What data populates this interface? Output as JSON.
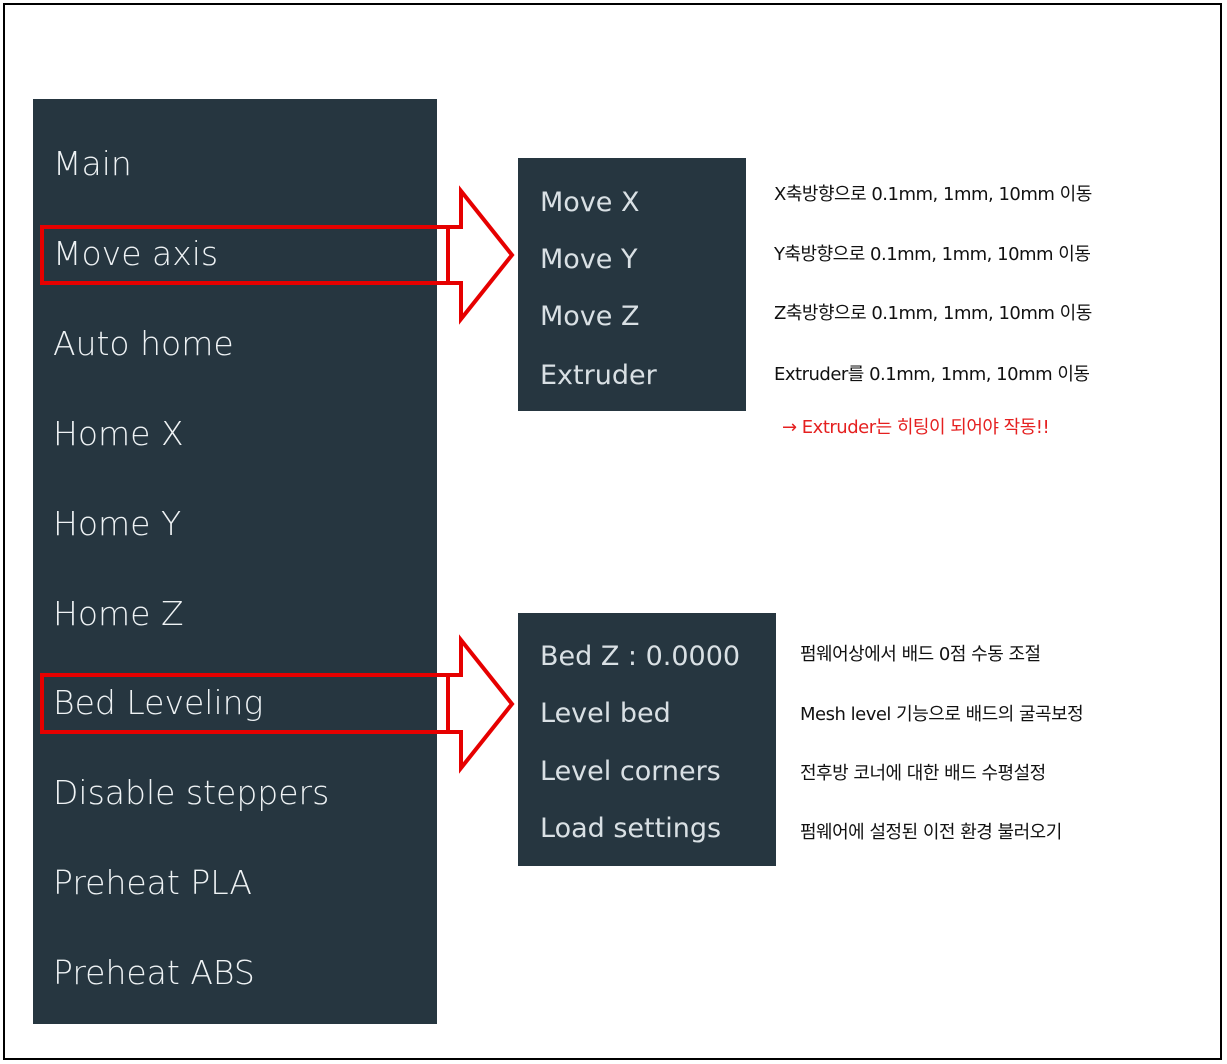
{
  "main_menu": {
    "items": [
      "Main",
      "Move axis",
      "Auto home",
      "Home X",
      "Home Y",
      "Home Z",
      "Bed Leveling",
      "Disable steppers",
      "Preheat PLA",
      "Preheat ABS"
    ]
  },
  "move_submenu": {
    "items": [
      "Move X",
      "Move Y",
      "Move Z",
      "Extruder"
    ]
  },
  "move_descriptions": [
    "X축방향으로 0.1mm, 1mm, 10mm 이동",
    "Y축방향으로 0.1mm, 1mm, 10mm 이동",
    "Z축방향으로 0.1mm, 1mm, 10mm 이동",
    "Extruder를 0.1mm, 1mm, 10mm 이동"
  ],
  "extruder_note": "→ Extruder는 히팅이 되어야 작동!!",
  "bed_submenu": {
    "items": [
      "Bed Z : 0.0000",
      "Level bed",
      "Level corners",
      "Load settings"
    ]
  },
  "bed_descriptions": [
    "펌웨어상에서 배드 0점 수동 조절",
    "Mesh level 기능으로 배드의 굴곡보정",
    "전후방 코너에 대한 배드 수평설정",
    "펌웨어에 설정된 이전 환경 불러오기"
  ],
  "colors": {
    "panel": "#263640",
    "highlight": "#e60000",
    "note": "#e52020"
  }
}
